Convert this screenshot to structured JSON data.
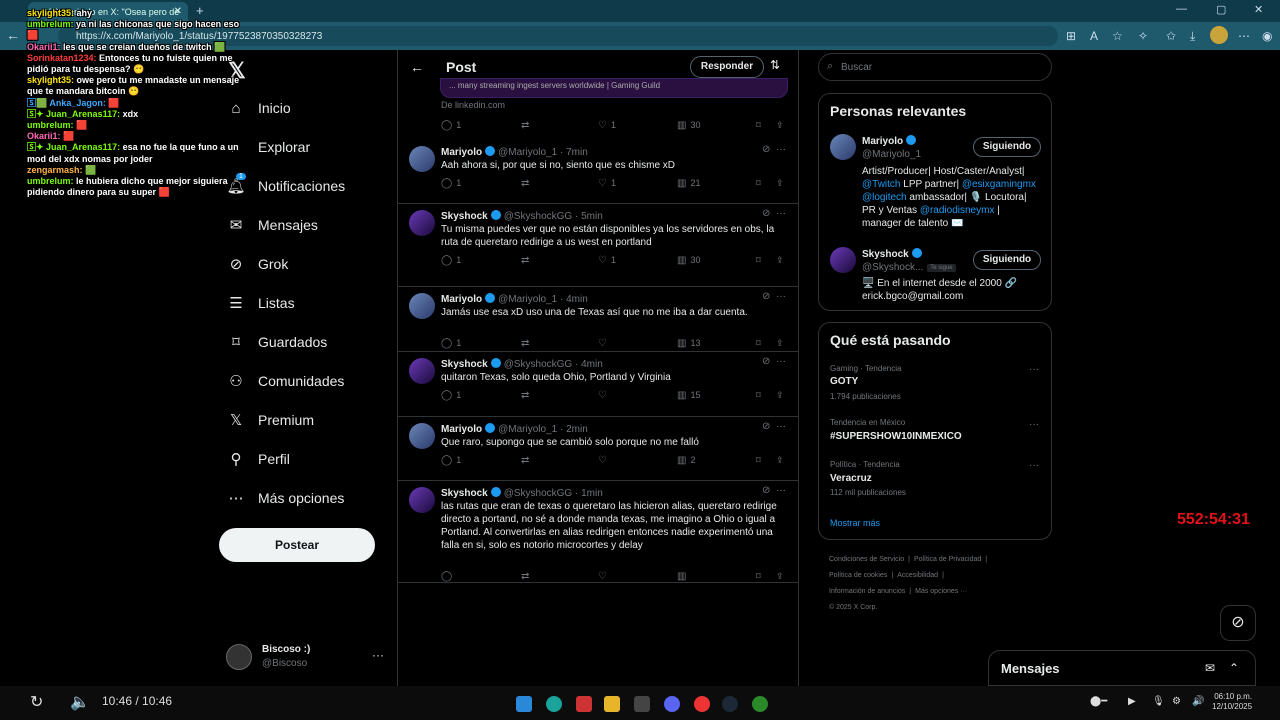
{
  "browser": {
    "tab_title": "(4) Mariyolo en X: \"Osea pero de",
    "url": "https://x.com/Mariyolo_1/status/1977523870350328273"
  },
  "nav": {
    "items": [
      {
        "label": "Inicio",
        "icon": "home-icon"
      },
      {
        "label": "Explorar",
        "icon": "search-icon"
      },
      {
        "label": "Notificaciones",
        "icon": "bell-icon",
        "badge": "1"
      },
      {
        "label": "Mensajes",
        "icon": "mail-icon"
      },
      {
        "label": "Grok",
        "icon": "grok-icon"
      },
      {
        "label": "Listas",
        "icon": "list-icon"
      },
      {
        "label": "Guardados",
        "icon": "bookmark-icon"
      },
      {
        "label": "Comunidades",
        "icon": "people-icon"
      },
      {
        "label": "Premium",
        "icon": "x-icon"
      },
      {
        "label": "Perfil",
        "icon": "person-icon"
      },
      {
        "label": "Más opciones",
        "icon": "more-icon"
      }
    ],
    "post_button": "Postear",
    "me": {
      "name": "Biscoso :)",
      "handle": "@Biscoso"
    }
  },
  "post_header": {
    "title": "Post",
    "reply_button": "Responder"
  },
  "link_card": {
    "title": "... many streaming ingest servers worldwide | Gaming Guild",
    "source": "De linkedin.com"
  },
  "top_actions": {
    "replies": "1",
    "reposts": "",
    "likes": "1",
    "views": "30"
  },
  "tweets": [
    {
      "name": "Mariyolo",
      "handle": "@Mariyolo_1",
      "time": "7min",
      "text": "Aah ahora si, por que si no, siento que es chisme xD",
      "replies": "1",
      "likes": "1",
      "views": "21",
      "avatar": "mariyolo"
    },
    {
      "name": "Skyshock",
      "handle": "@SkyshockGG",
      "time": "5min",
      "text": "Tu misma puedes ver que no están disponibles ya los servidores en obs, la ruta de queretaro redirige a us west en portland",
      "replies": "1",
      "likes": "1",
      "views": "30",
      "avatar": "skyshock"
    },
    {
      "name": "Mariyolo",
      "handle": "@Mariyolo_1",
      "time": "4min",
      "text": "Jamás use esa xD uso una de Texas así que no me iba a dar cuenta.",
      "replies": "1",
      "likes": "",
      "views": "13",
      "avatar": "mariyolo"
    },
    {
      "name": "Skyshock",
      "handle": "@SkyshockGG",
      "time": "4min",
      "text": "quitaron Texas, solo queda Ohio, Portland y Virginia",
      "replies": "1",
      "likes": "",
      "views": "15",
      "avatar": "skyshock"
    },
    {
      "name": "Mariyolo",
      "handle": "@Mariyolo_1",
      "time": "2min",
      "text": "Que raro, supongo que se cambió solo porque no me falló",
      "replies": "1",
      "likes": "",
      "views": "2",
      "avatar": "mariyolo"
    },
    {
      "name": "Skyshock",
      "handle": "@SkyshockGG",
      "time": "1min",
      "text": "las rutas que eran de texas o queretaro las hicieron alias, queretaro redirige directo a portand, no sé a donde manda texas, me imagino a Ohio o igual a Portland. Al convertirlas en alias redirigen entonces nadie experimentó una falla en si, solo es notorio microcortes y delay",
      "replies": "",
      "likes": "",
      "views": "",
      "avatar": "skyshock"
    }
  ],
  "search": {
    "placeholder": "Buscar"
  },
  "relevant": {
    "title": "Personas relevantes",
    "people": [
      {
        "name": "Mariyolo",
        "handle": "@Mariyolo_1",
        "button": "Siguiendo",
        "bio": [
          "Artist/Producer| Host/Caster/Analyst|",
          "@Twitch LPP partner| @esixgamingmx",
          "@logitech ambassador| 🎙️ Locutora|",
          "PR y Ventas @radiodisneymx |",
          "manager de talento ✉️"
        ]
      },
      {
        "name": "Skyshock",
        "handle": "@Skyshock...",
        "follows_you": "Te sigue",
        "button": "Siguiendo",
        "bio": [
          "🖥️ En el internet desde el 2000 🔗",
          "erick.bgco@gmail.com"
        ]
      }
    ]
  },
  "trends": {
    "title": "Qué está pasando",
    "items": [
      {
        "category": "Gaming · Tendencia",
        "name": "GOTY",
        "count": "1.794 publicaciones"
      },
      {
        "category": "Tendencia en México",
        "name": "#SUPERSHOW10INMEXICO",
        "count": ""
      },
      {
        "category": "Política · Tendencia",
        "name": "Veracruz",
        "count": "112 mil publicaciones"
      }
    ],
    "show_more": "Mostrar más"
  },
  "footer": [
    "Condiciones de Servicio",
    "|",
    "Política de Privacidad",
    "|",
    "Política de cookies",
    "|",
    "Accesibilidad",
    "|",
    "Información de anuncios",
    "|",
    "Más opciones ···",
    "© 2025 X Corp."
  ],
  "messages_dock": {
    "title": "Mensajes"
  },
  "chat_overlay": [
    {
      "user": "skylight35:",
      "msg": "ahy",
      "color": "#ffe600"
    },
    {
      "user": "umbrelum:",
      "msg": "ya ni las chiconas que sigo hacen eso 🟥",
      "color": "#7cfc00"
    },
    {
      "user": "Okarii1:",
      "msg": "les que se creian dueños de twitch 🟩",
      "color": "#ff69b4"
    },
    {
      "user": "Sorinkatan1234:",
      "msg": "Entonces tu no fuiste quien me pidió para tu despensa? 😶",
      "color": "#ff3b3b"
    },
    {
      "user": "skylight35:",
      "msg": "owe pero tu me mnadaste un mensaje que te mandara bitcoin 😶",
      "color": "#ffe600"
    },
    {
      "user": "🅂🟩 Anka_Jagon:",
      "msg": "🟥",
      "color": "#3fa9ff"
    },
    {
      "user": "🅂✦ Juan_Arenas117:",
      "msg": "xdx",
      "color": "#7cfc00"
    },
    {
      "user": "umbrelum:",
      "msg": "🟥",
      "color": "#7cfc00"
    },
    {
      "user": "Okarii1:",
      "msg": "🟥",
      "color": "#ff69b4"
    },
    {
      "user": "🅂✦ Juan_Arenas117:",
      "msg": "esa no fue la que funo a un mod del xdx nomas por joder",
      "color": "#7cfc00"
    },
    {
      "user": "zengarmash:",
      "msg": "🟩",
      "color": "#ffb347"
    },
    {
      "user": "umbrelum:",
      "msg": "le hubiera dicho que mejor siguiera pidiendo dinero para su super 🟥",
      "color": "#7cfc00"
    }
  ],
  "timer": "552:54:31",
  "player": {
    "time": "10:46 / 10:46"
  },
  "clock": {
    "time": "06:10 p.m.",
    "date": "12/10/2025"
  }
}
